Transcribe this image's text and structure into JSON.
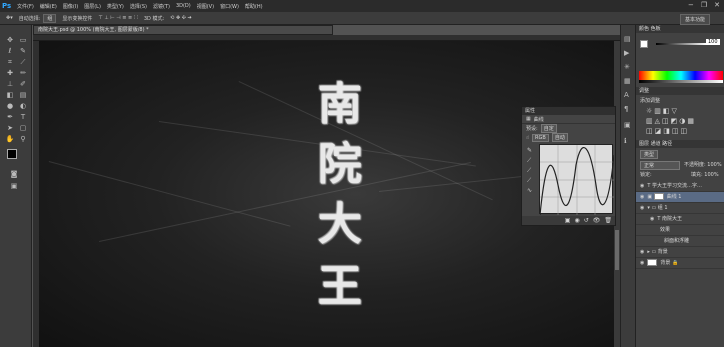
{
  "app": {
    "logo": "Ps"
  },
  "menu": [
    "文件(F)",
    "编辑(E)",
    "图像(I)",
    "图层(L)",
    "类型(Y)",
    "选择(S)",
    "滤镜(T)",
    "3D(D)",
    "视图(V)",
    "窗口(W)",
    "帮助(H)"
  ],
  "window_controls": {
    "min": "−",
    "max": "❐",
    "close": "✕"
  },
  "options": {
    "auto_select": "自动选择:",
    "layer_select": "组",
    "transform": "显示变换控件",
    "mode_3d": "3D 模式:"
  },
  "workspace": "基本功能",
  "document": {
    "tab_title": "南院大王.psd @ 100% (南院大王, 图层蒙版/8) *"
  },
  "canvas_text": [
    "南",
    "院",
    "大",
    "王"
  ],
  "curves": {
    "panel_title": "属性",
    "sub_title": "曲线",
    "preset_label": "预设:",
    "preset_value": "自定",
    "channel_value": "RGB",
    "auto_label": "自动"
  },
  "right": {
    "color_tab": "颜色 色板",
    "opacity_value": "100",
    "adjust_tab": "调整",
    "adjust_label": "添加调整",
    "layers_tabs": "图层 通道 路径",
    "kind": "类型",
    "blend": "正常",
    "opacity_label": "不透明度: 100%",
    "lock_label": "锁定:",
    "fill_label": "填充: 100%",
    "layers": [
      {
        "name": "学大王学习交流…字…",
        "type": "T"
      },
      {
        "name": "曲线 1",
        "type": "adj"
      },
      {
        "name": "组 1",
        "type": "group"
      },
      {
        "name": "南院大王",
        "type": "T"
      },
      {
        "name": "效果",
        "type": "fx"
      },
      {
        "name": "斜面和浮雕",
        "type": "fx"
      },
      {
        "name": "背景",
        "type": "group"
      },
      {
        "name": "背景",
        "type": "bg"
      }
    ]
  },
  "icons": [
    "move-icon",
    "marquee-icon",
    "lasso-icon",
    "quick-select-icon",
    "crop-icon",
    "eyedropper-icon",
    "heal-icon",
    "brush-icon",
    "stamp-icon",
    "history-brush-icon",
    "eraser-icon",
    "gradient-icon",
    "blur-icon",
    "dodge-icon",
    "pen-icon",
    "type-icon",
    "path-select-icon",
    "shape-icon",
    "hand-icon",
    "zoom-icon"
  ]
}
